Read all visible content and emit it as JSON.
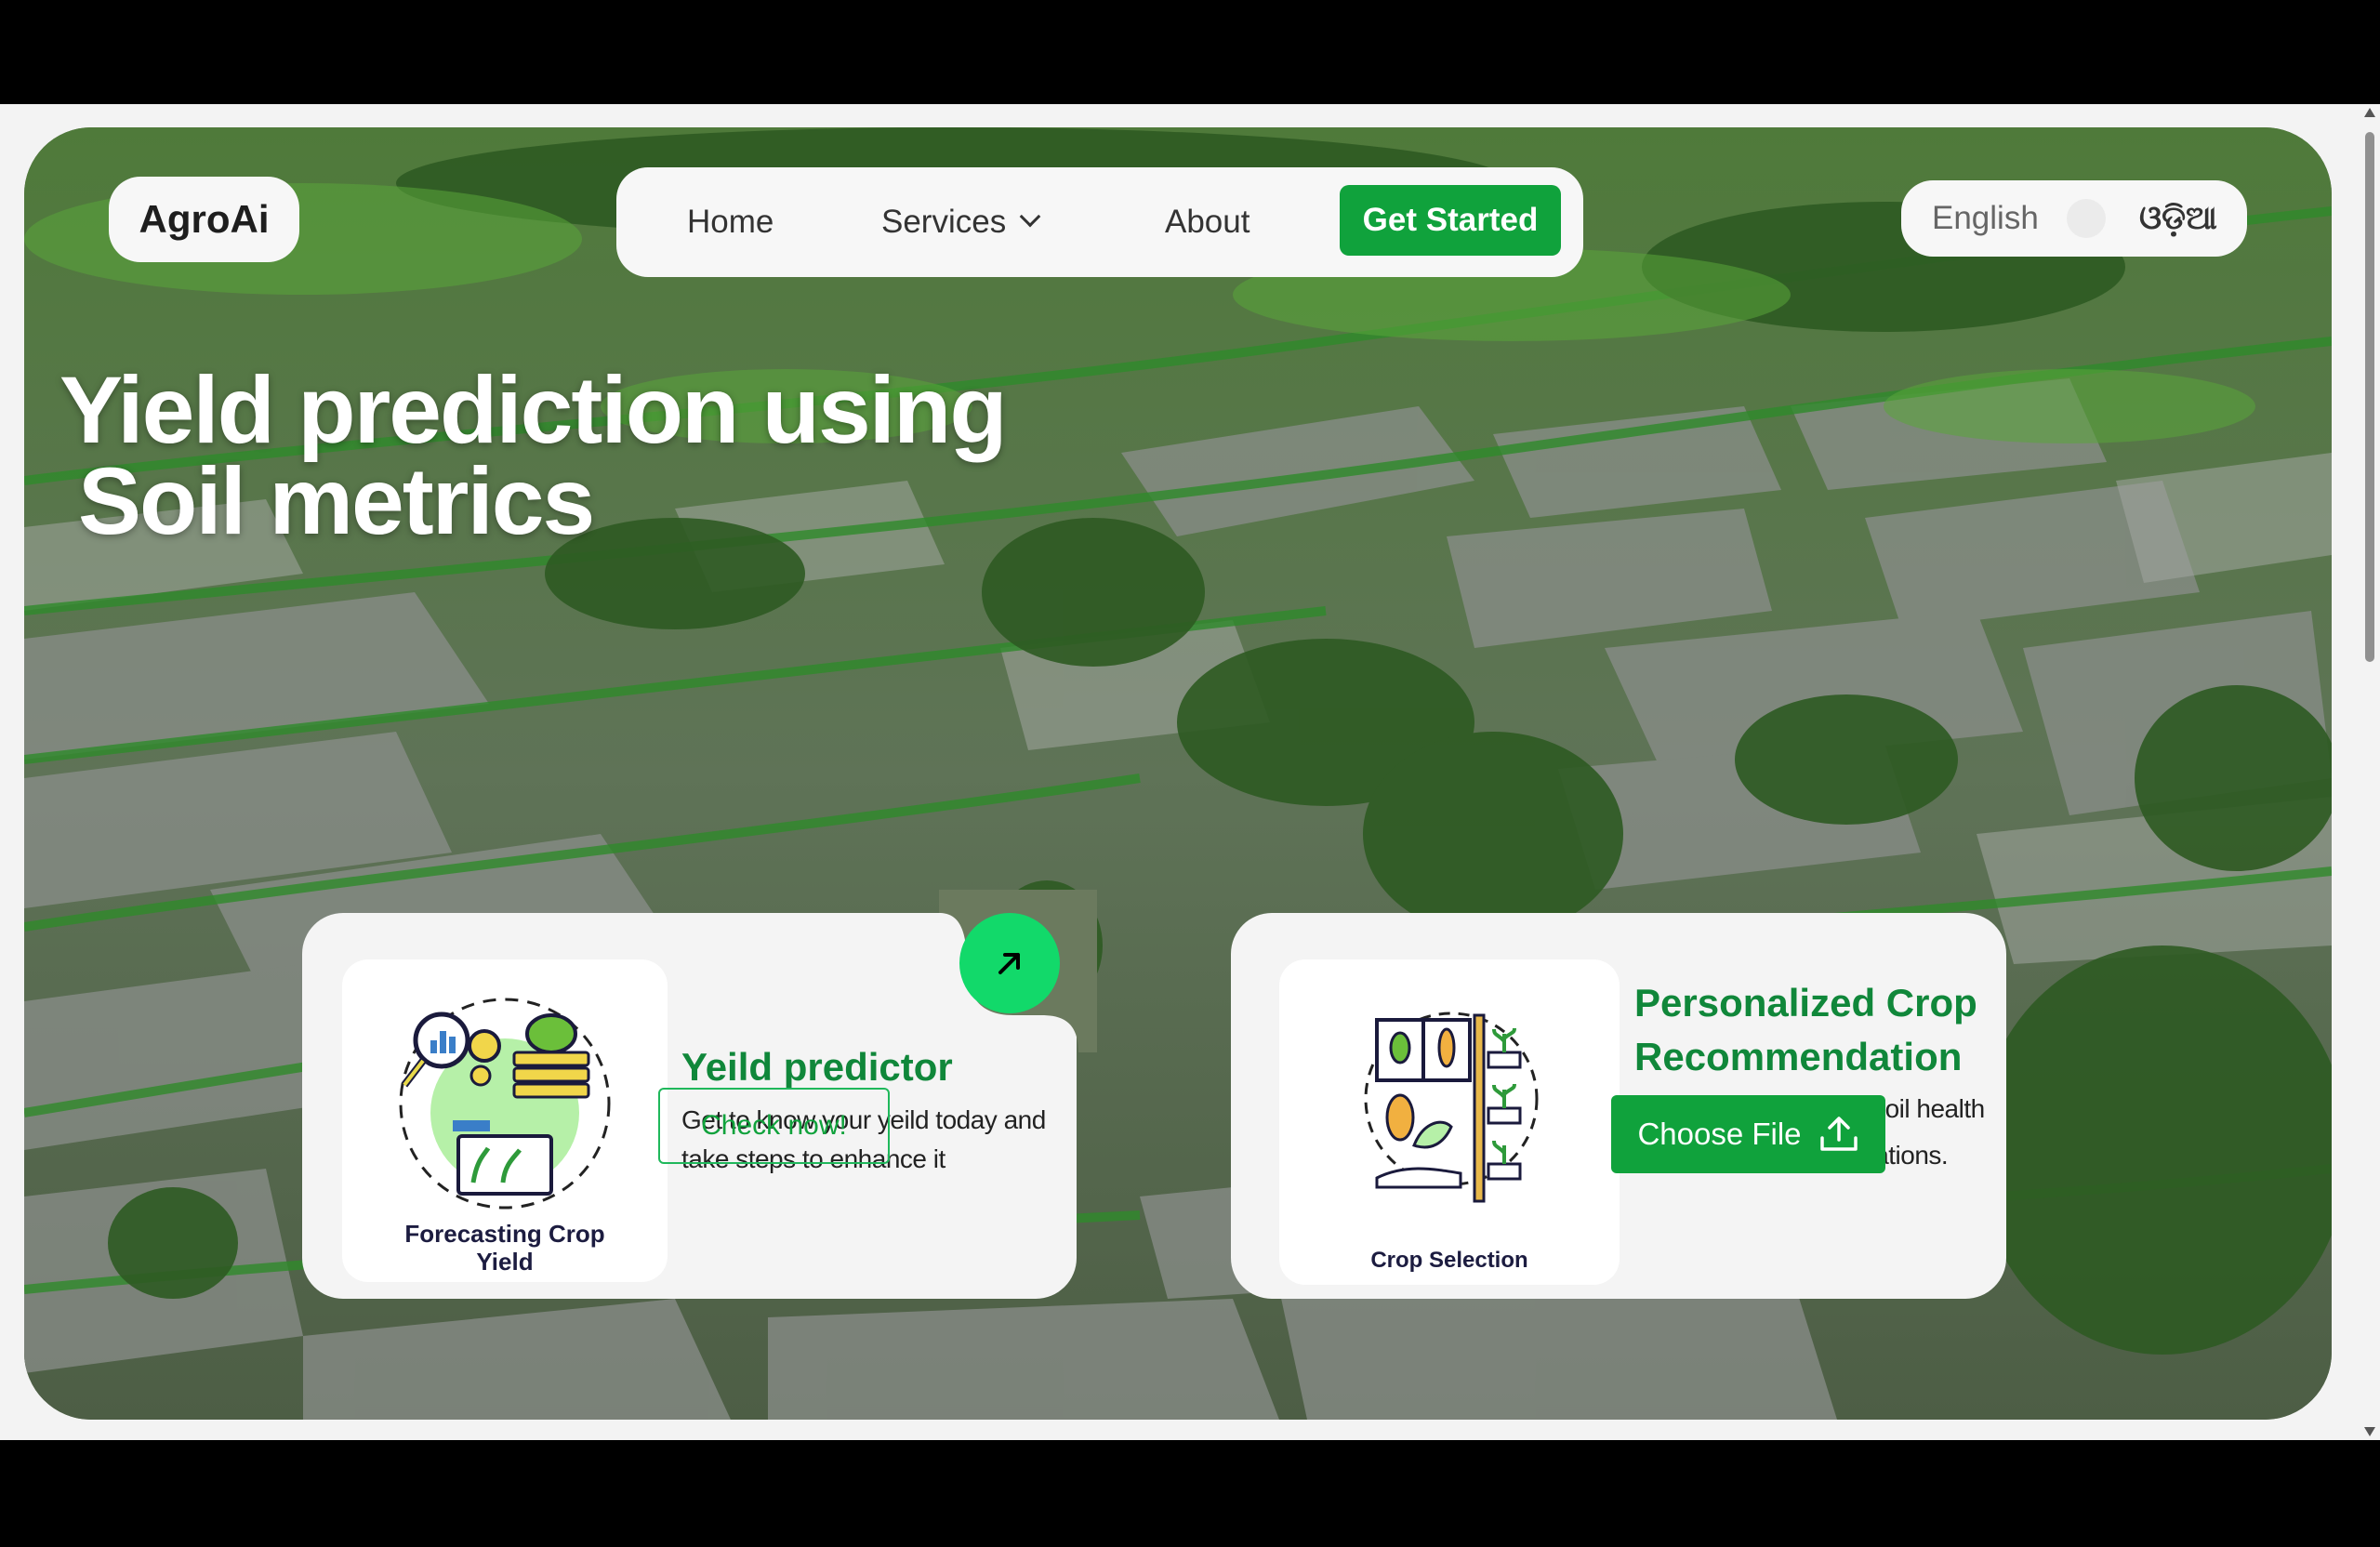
{
  "brand": {
    "logo_text": "AgroAi"
  },
  "nav": {
    "home": "Home",
    "services": "Services",
    "about": "About",
    "cta": "Get Started"
  },
  "language": {
    "english": "English",
    "odia": "ଓଡ଼ିଆ"
  },
  "hero": {
    "title_line1": "Yield prediction using",
    "title_line2": "Soil metrics"
  },
  "cards": {
    "yield": {
      "illustration_caption_1": "Forecasting Crop",
      "illustration_caption_2": "Yield",
      "title": "Yeild predictor",
      "description": "Get to know your yeild today and take steps to enhance it",
      "button": "Check now!",
      "arrow_icon": "arrow-up-right-icon"
    },
    "crop": {
      "illustration_caption": "Crop Selection",
      "title": "Personalized Crop Recommendation",
      "description": "Upload your SHC for soil health and yield recommendations.",
      "button": "Choose File",
      "button_icon": "upload-icon"
    }
  },
  "colors": {
    "accent": "#10a23c",
    "accent_bright": "#12d96a",
    "title_green": "#10873a",
    "pill_bg": "#f7f7f7",
    "card_bg": "#f4f4f4"
  }
}
